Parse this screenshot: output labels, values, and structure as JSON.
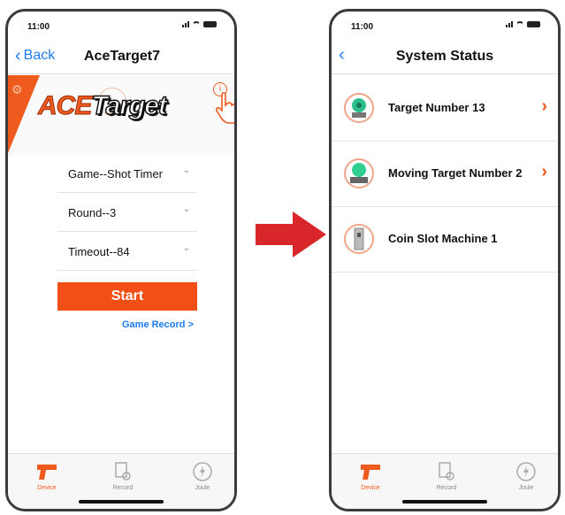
{
  "left_screen": {
    "status_time": "11:00",
    "back_label": "Back",
    "title": "AceTarget7",
    "logo_left": "ACE",
    "logo_right": "Target",
    "info_glyph": "i",
    "selects": [
      {
        "label": "Game--Shot Timer"
      },
      {
        "label": "Round--3"
      },
      {
        "label": "Timeout--84"
      }
    ],
    "start_label": "Start",
    "game_record_label": "Game Record >",
    "tabs": [
      {
        "label": "Device",
        "icon": "pistol-icon",
        "active": true
      },
      {
        "label": "Record",
        "icon": "record-icon",
        "active": false
      },
      {
        "label": "Joule",
        "icon": "joule-icon",
        "active": false
      }
    ]
  },
  "right_screen": {
    "status_time": "11:00",
    "title": "System Status",
    "items": [
      {
        "name": "Target Number  13",
        "icon": "target-icon",
        "has_arrow": true
      },
      {
        "name": "Moving Target Number  2",
        "icon": "moving-target-icon",
        "has_arrow": true
      },
      {
        "name": "Coin Slot Machine  1",
        "icon": "coin-slot-icon",
        "has_arrow": false
      }
    ],
    "tabs": [
      {
        "label": "Device",
        "icon": "pistol-icon",
        "active": true
      },
      {
        "label": "Record",
        "icon": "record-icon",
        "active": false
      },
      {
        "label": "Joule",
        "icon": "joule-icon",
        "active": false
      }
    ]
  },
  "colors": {
    "accent_orange": "#ef5a1f",
    "link_blue": "#1e7bf2",
    "arrow_red": "#d8262b"
  }
}
